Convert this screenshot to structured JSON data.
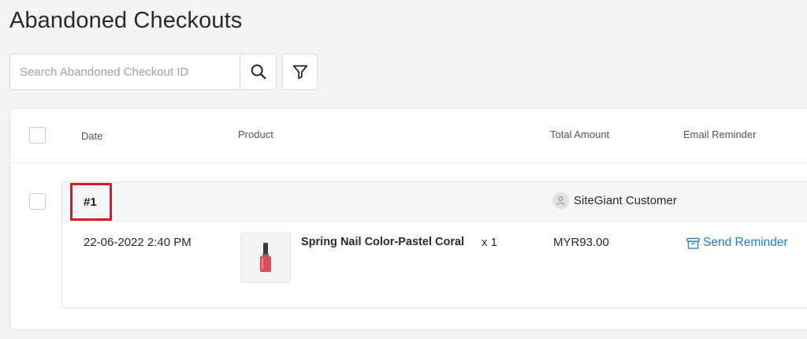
{
  "page": {
    "title": "Abandoned Checkouts"
  },
  "search": {
    "placeholder": "Search Abandoned Checkout ID"
  },
  "table": {
    "columns": {
      "date": "Date",
      "product": "Product",
      "total": "Total Amount",
      "email": "Email Reminder"
    }
  },
  "orders": [
    {
      "id": "#1",
      "customer": "SiteGiant Customer",
      "date": "22-06-2022 2:40 PM",
      "product_name": "Spring Nail Color-Pastel Coral",
      "quantity": "x 1",
      "total": "MYR93.00",
      "reminder_label": "Send Reminder"
    }
  ],
  "colors": {
    "accent": "#1e7fcf",
    "highlight": "#e0161c",
    "nail_polish": "#d94d5a"
  },
  "icons": [
    "search-icon",
    "filter-icon",
    "user-icon",
    "nail-polish-image",
    "archive-box-icon"
  ]
}
